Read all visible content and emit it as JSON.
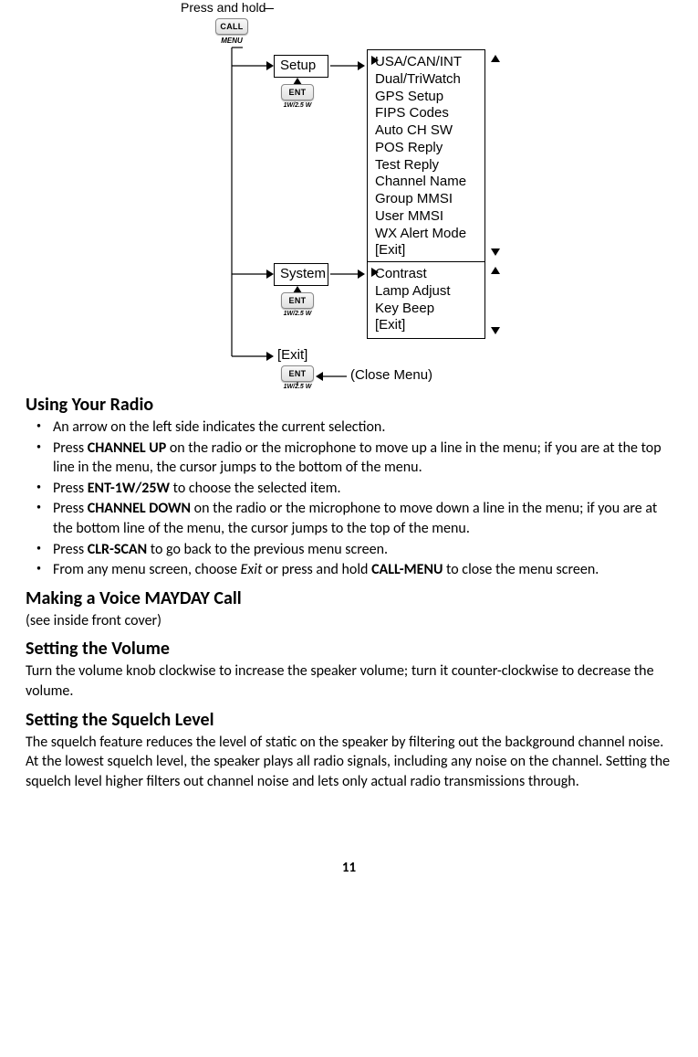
{
  "diagram": {
    "press_hold": "Press and hold -",
    "call_btn": "CALL",
    "call_sub": "MENU",
    "ent_btn": "ENT",
    "ent_sub": "1W/2.5 W",
    "setup": "Setup",
    "system": "System",
    "exit": "[Exit]",
    "close_menu": "(Close Menu)",
    "setup_items": "USA/CAN/INT\nDual/TriWatch\nGPS Setup\nFIPS Codes\nAuto CH SW\nPOS Reply\nTest Reply\nChannel Name\nGroup MMSI\nUser MMSI\nWX Alert Mode\n[Exit]",
    "system_items": "Contrast\nLamp Adjust\nKey Beep\n[Exit]"
  },
  "sections": {
    "using_radio": {
      "title": "Using Your Radio",
      "b1_pre": "An arrow on the left side indicates the current selection.",
      "b2_pre": "Press ",
      "b2_term": "CHANNEL UP",
      "b2_post": " on the radio or the microphone to move up a line in the menu; if you are at the top line in the menu, the cursor jumps to the bottom of the menu.",
      "b3_pre": "Press ",
      "b3_term": "ENT-1W/25W",
      "b3_post": " to choose the selected item.",
      "b4_pre": "Press ",
      "b4_term": "CHANNEL DOWN",
      "b4_post": " on the radio or the microphone to move down a line in the menu; if you are at the bottom line of the menu, the cursor jumps to the top of the menu.",
      "b5_pre": "Press ",
      "b5_term": "CLR-SCAN",
      "b5_post": " to go back to the previous menu screen.",
      "b6_pre": "From any menu screen, choose ",
      "b6_italic": "Exit",
      "b6_mid": " or press and hold ",
      "b6_term": "CALL-MENU",
      "b6_post": " to close the menu screen."
    },
    "mayday": {
      "title": "Making a Voice MAYDAY Call",
      "body": "(see inside front cover)"
    },
    "volume": {
      "title": "Setting the Volume",
      "body": "Turn the volume knob clockwise to increase the speaker volume; turn it counter-clockwise to decrease the volume."
    },
    "squelch": {
      "title": "Setting the Squelch Level",
      "body": "The squelch feature reduces the level of static on the speaker by filtering out the background channel noise. At the lowest squelch level, the speaker plays all radio signals, including any noise on the channel. Setting the squelch level higher filters out channel noise and lets only actual radio transmissions through."
    }
  },
  "page_number": "11"
}
